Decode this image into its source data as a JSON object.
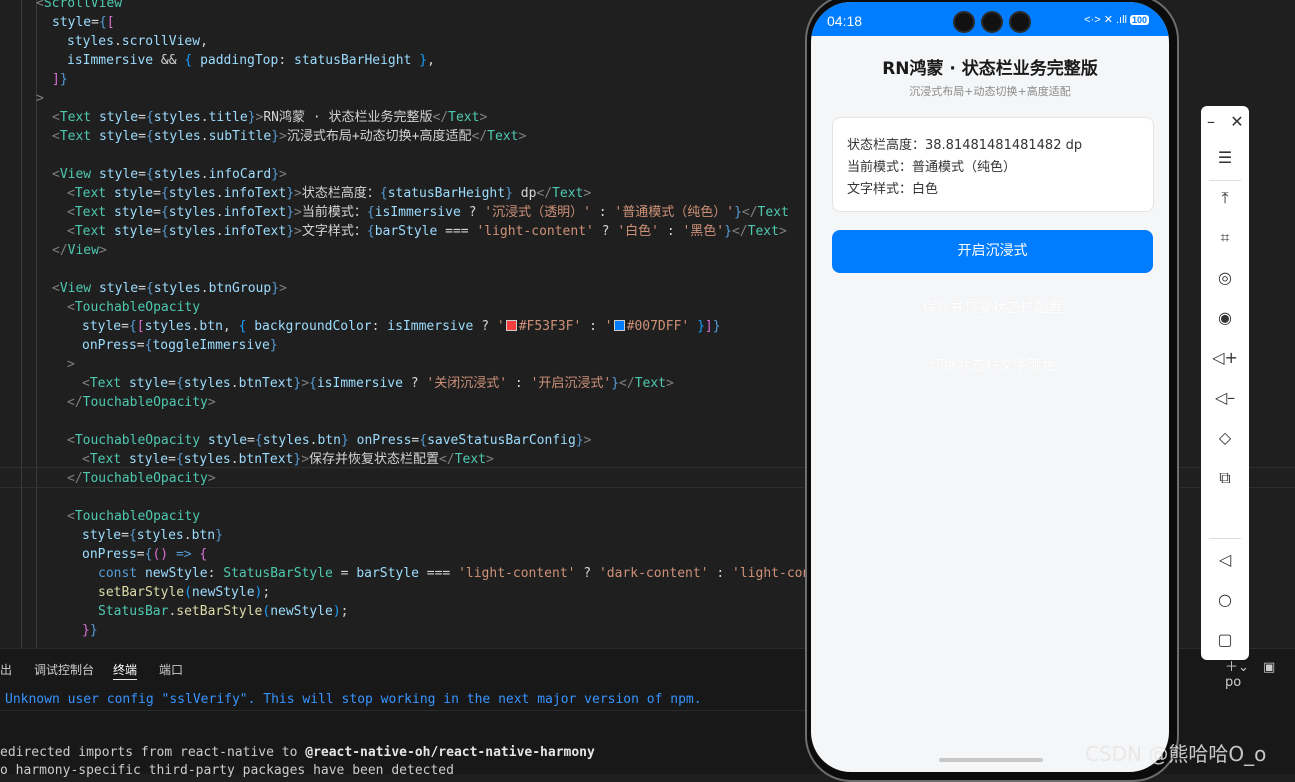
{
  "editor": {
    "lines": [
      "<ScrollView",
      "  style={[",
      "    styles.scrollView,",
      "    isImmersive && { paddingTop: statusBarHeight },",
      "  ]}",
      ">",
      "  <Text style={styles.title}>RN鸿蒙 · 状态栏业务完整版</Text>",
      "  <Text style={styles.subTitle}>沉浸式布局+动态切换+高度适配</Text>",
      "",
      "  <View style={styles.infoCard}>",
      "    <Text style={styles.infoText}>状态栏高度：{statusBarHeight} dp</Text>",
      "    <Text style={styles.infoText}>当前模式：{isImmersive ? '沉浸式（透明）' : '普通模式（纯色）'}</Text>",
      "    <Text style={styles.infoText}>文字样式：{barStyle === 'light-content' ? '白色' : '黑色'}</Text>",
      "  </View>",
      "",
      "  <View style={styles.btnGroup}>",
      "    <TouchableOpacity",
      "      style={[styles.btn, { backgroundColor: isImmersive ? '#F53F3F' : '#007DFF' }]}",
      "      onPress={toggleImmersive}",
      "    >",
      "      <Text style={styles.btnText}>{isImmersive ? '关闭沉浸式' : '开启沉浸式'}</Text>",
      "    </TouchableOpacity>",
      "",
      "    <TouchableOpacity style={styles.btn} onPress={saveStatusBarConfig}>",
      "      <Text style={styles.btnText}>保存并恢复状态栏配置</Text>",
      "    </TouchableOpacity>",
      "",
      "    <TouchableOpacity",
      "      style={styles.btn}",
      "      onPress={() => {",
      "        const newStyle: StatusBarStyle = barStyle === 'light-content' ? 'dark-content' : 'light-cont",
      "        setBarStyle(newStyle);",
      "        StatusBar.setBarStyle(newStyle);",
      "      }}"
    ]
  },
  "panel": {
    "tabs": [
      "出",
      "调试控制台",
      "终端",
      "端口"
    ],
    "active_tab": "终端",
    "terminal_lines": [
      "Unknown user config \"sslVerify\". This will stop working in the next major version of npm.",
      "edirected imports from react-native to @react-native-oh/react-native-harmony",
      "o harmony-specific third-party packages have been detected"
    ],
    "right_label": "po"
  },
  "phone": {
    "time": "04:18",
    "battery": "100",
    "status_icons": "<·> ✕ .ıll",
    "app_title": "RN鸿蒙 · 状态栏业务完整版",
    "app_subtitle": "沉浸式布局+动态切换+高度适配",
    "info": {
      "height_line": "状态栏高度：38.81481481481482 dp",
      "mode_line": "当前模式：普通模式（纯色）",
      "text_style_line": "文字样式：白色"
    },
    "buttons": {
      "toggle": "开启沉浸式",
      "save": "保存并恢复状态栏配置",
      "switch_style": "切换状态栏文字颜色"
    },
    "colors": {
      "accent": "#007DFF",
      "danger": "#F53F3F"
    }
  },
  "toolbar": {
    "icons": [
      "minimize-icon",
      "close-icon",
      "menu-icon",
      "pin-top-icon",
      "crop-icon",
      "rotate-icon",
      "record-icon",
      "volume-up-icon",
      "volume-down-icon",
      "shake-icon",
      "multi-device-icon",
      "back-icon",
      "home-icon",
      "recents-icon"
    ]
  },
  "watermark": "CSDN @熊哈哈O_o"
}
